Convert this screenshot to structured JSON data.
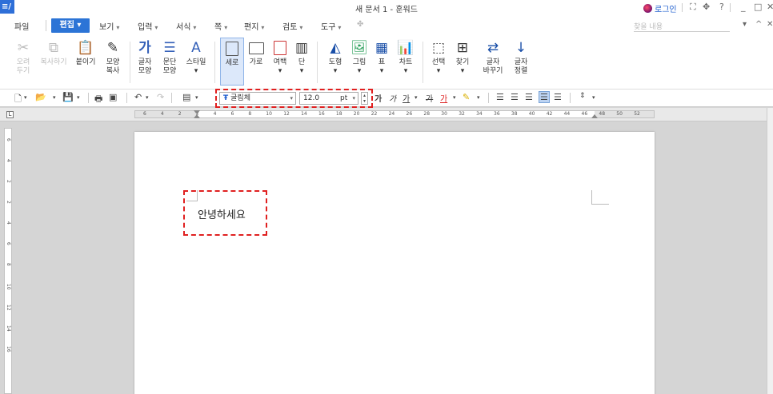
{
  "titlebar": {
    "title": "새 문서 1 - 훈워드",
    "login": "로그인",
    "help": "?"
  },
  "menubar": {
    "items": [
      {
        "label": "파일"
      },
      {
        "label": "편집"
      },
      {
        "label": "보기"
      },
      {
        "label": "입력"
      },
      {
        "label": "서식"
      },
      {
        "label": "쪽"
      },
      {
        "label": "편지"
      },
      {
        "label": "검토"
      },
      {
        "label": "도구"
      }
    ],
    "search_placeholder": "찾을 내용"
  },
  "ribbon": {
    "cut": "오려\n두기",
    "copy": "복사하기",
    "paste": "붙이기",
    "format_copy": "모양\n복사",
    "char_shape": "글자\n모양",
    "para_shape": "문단\n모양",
    "style": "스타일",
    "vertical": "세로",
    "horizontal": "가로",
    "margin": "여백",
    "column": "단",
    "shape": "도형",
    "picture": "그림",
    "table": "표",
    "chart": "차트",
    "select": "선택",
    "find": "찾기",
    "replace": "글자\n바꾸기",
    "sort": "글자\n정렬"
  },
  "format": {
    "font_name": "굴림체",
    "font_size": "12.0",
    "unit": "pt"
  },
  "ruler": {
    "numbers": [
      "6",
      "4",
      "2",
      "2",
      "4",
      "6",
      "8",
      "10",
      "12",
      "14",
      "16",
      "18",
      "20",
      "22",
      "24",
      "26",
      "28",
      "30",
      "32",
      "34",
      "36",
      "38",
      "40",
      "42",
      "44",
      "46",
      "48",
      "50",
      "52"
    ]
  },
  "vruler": {
    "numbers": [
      "6",
      "4",
      "2",
      "2",
      "4",
      "6",
      "8",
      "10",
      "12",
      "14",
      "16"
    ]
  },
  "document": {
    "text": "안녕하세요"
  },
  "colors": {
    "accent": "#2c74d6",
    "highlight": "#e02020",
    "login": "#1f5fcf"
  }
}
